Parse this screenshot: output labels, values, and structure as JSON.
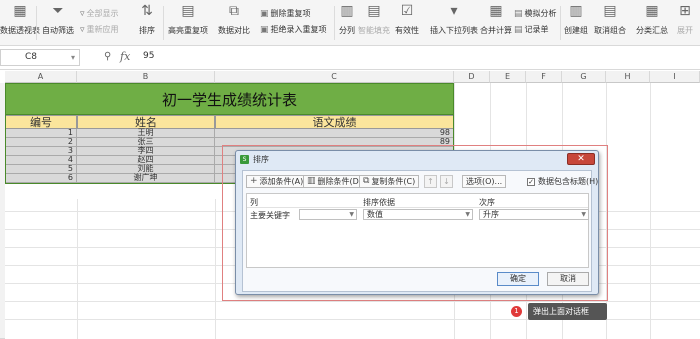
{
  "ribbon": {
    "pivot_label": "数据透视表",
    "auto_filter_label": "自动筛选",
    "show_all_label": "全部显示",
    "reapply_label": "重新应用",
    "sort_label": "排序",
    "highlight_dup_label": "高亮重复项",
    "data_compare_label": "数据对比",
    "remove_dup_label": "删除重复项",
    "reject_dup_label": "拒绝录入重复项",
    "split_label": "分列",
    "smart_fill_label": "智能填充",
    "validity_label": "有效性",
    "insert_dropdown_label": "插入下拉列表",
    "consolidate_label": "合并计算",
    "simulate_label": "模拟分析",
    "record_label": "记录单",
    "create_group_label": "创建组",
    "ungroup_label": "取消组合",
    "subtotal_label": "分类汇总",
    "show_detail_label": "展开"
  },
  "formula_bar": {
    "cell_ref": "C8",
    "fx": "fx",
    "value": "95"
  },
  "columns": [
    "A",
    "B",
    "C",
    "D",
    "E",
    "F",
    "G",
    "H",
    "I"
  ],
  "sheet": {
    "title": "初一学生成绩统计表",
    "headers": [
      "编号",
      "姓名",
      "语文成绩"
    ],
    "rows": [
      {
        "id": "1",
        "name": "王明",
        "score": "98"
      },
      {
        "id": "2",
        "name": "张三",
        "score": "89"
      },
      {
        "id": "3",
        "name": "李四",
        "score": ""
      },
      {
        "id": "4",
        "name": "赵四",
        "score": ""
      },
      {
        "id": "5",
        "name": "刘能",
        "score": ""
      },
      {
        "id": "6",
        "name": "谢广坤",
        "score": ""
      }
    ]
  },
  "dialog": {
    "title": "排序",
    "close": "✕",
    "add_condition": "添加条件(A)",
    "delete_condition": "删除条件(D)",
    "copy_condition": "复制条件(C)",
    "up": "↑",
    "down": "↓",
    "options": "选项(O)...",
    "has_header": "数据包含标题(H)",
    "col_header": "列",
    "sort_on_header": "排序依据",
    "order_header": "次序",
    "primary_key_label": "主要关键字",
    "primary_key_value": "",
    "sort_on_value": "数值",
    "order_value": "升序",
    "ok": "确定",
    "cancel": "取消"
  },
  "annotation": {
    "number": "1",
    "text": "弹出上面对话框"
  }
}
